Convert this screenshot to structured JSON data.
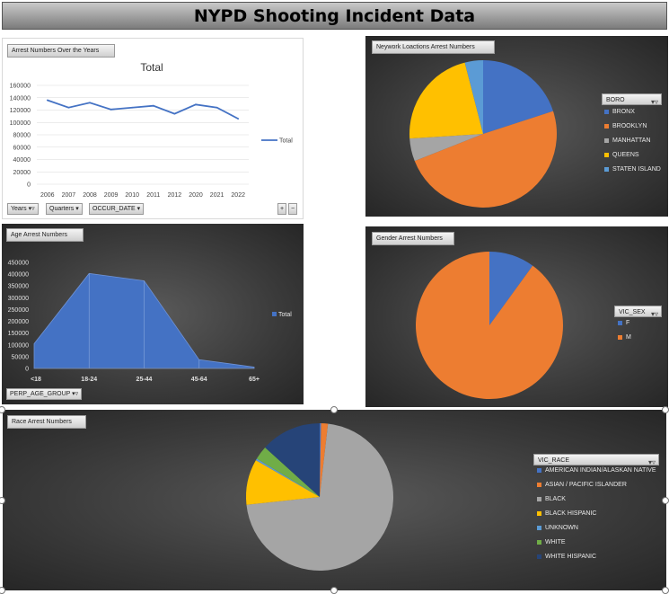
{
  "title": "NYPD Shooting Incident Data",
  "colors": {
    "blue": "#4472c4",
    "orange": "#ed7d31",
    "gray": "#a5a5a5",
    "gold": "#ffc000",
    "lightblue": "#5b9bd5",
    "green": "#70ad47",
    "navy": "#264478"
  },
  "line_panel": {
    "tag": "Arrest Numbers Over the Years",
    "buttons": [
      "Years",
      "Quarters",
      "OCCUR_DATE"
    ],
    "zoom": [
      "+",
      "−"
    ]
  },
  "location_panel": {
    "tag": "Neywork Loactions Arrest Numbers",
    "legend_title": "BORO"
  },
  "age_panel": {
    "tag": "Age  Arrest Numbers",
    "field_button": "PERP_AGE_GROUP"
  },
  "gender_panel": {
    "tag": "Gender Arrest Numbers",
    "legend_title": "VIC_SEX"
  },
  "race_panel": {
    "tag": "Race Arrest Numbers",
    "legend_title": "VIC_RACE"
  },
  "chart_data": [
    {
      "type": "line",
      "title": "Total",
      "x": [
        "2006",
        "2007",
        "2008",
        "2009",
        "2010",
        "2011",
        "2012",
        "2020",
        "2021",
        "2022"
      ],
      "series": [
        {
          "name": "Total",
          "values": [
            136000,
            124000,
            132000,
            121000,
            124000,
            127000,
            114000,
            129000,
            124000,
            106000
          ]
        }
      ],
      "ylim": [
        0,
        160000
      ],
      "yticks": [
        "0",
        "20000",
        "40000",
        "60000",
        "80000",
        "100000",
        "120000",
        "140000",
        "160000"
      ],
      "grid": true,
      "legend": "right"
    },
    {
      "type": "pie",
      "categories": [
        "BRONX",
        "BROOKLYN",
        "MANHATTAN",
        "QUEENS",
        "STATEN ISLAND"
      ],
      "values": [
        20,
        49,
        5,
        22,
        4
      ],
      "legend": "right"
    },
    {
      "type": "area",
      "categories": [
        "<18",
        "18-24",
        "25-44",
        "45-64",
        "65+"
      ],
      "series": [
        {
          "name": "Total",
          "values": [
            105000,
            403000,
            372000,
            37000,
            6000
          ]
        }
      ],
      "ylim": [
        0,
        450000
      ],
      "yticks": [
        "0",
        "50000",
        "100000",
        "150000",
        "200000",
        "250000",
        "300000",
        "350000",
        "400000",
        "450000"
      ],
      "legend": "right"
    },
    {
      "type": "pie",
      "categories": [
        "F",
        "M"
      ],
      "values": [
        10,
        90
      ],
      "legend": "right"
    },
    {
      "type": "pie",
      "categories": [
        "AMERICAN INDIAN/ALASKAN NATIVE",
        "ASIAN / PACIFIC ISLANDER",
        "BLACK",
        "BLACK HISPANIC",
        "UNKNOWN",
        "WHITE",
        "WHITE HISPANIC"
      ],
      "values": [
        0.3,
        1.5,
        71.5,
        10,
        0.4,
        3,
        13.3
      ],
      "legend": "right"
    }
  ]
}
